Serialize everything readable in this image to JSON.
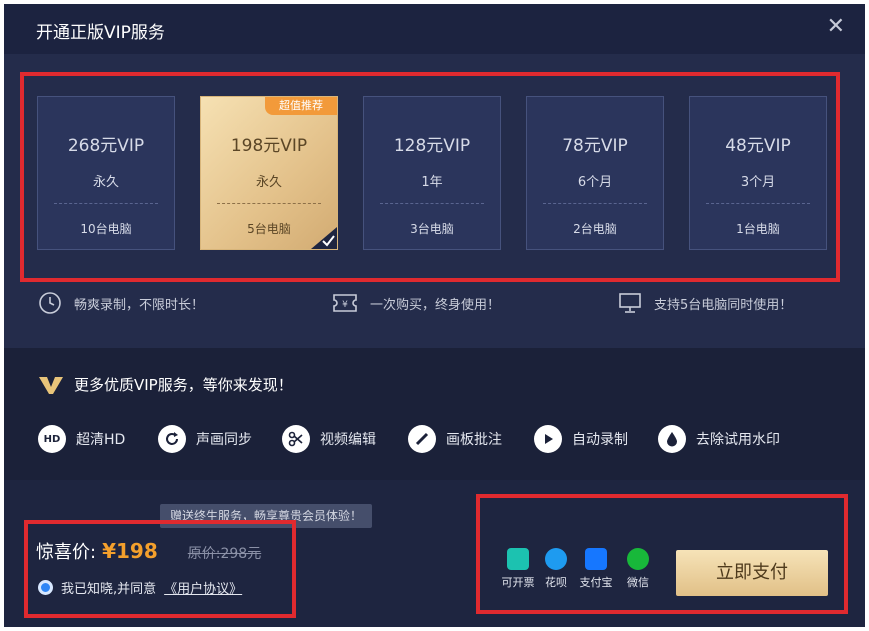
{
  "dialog": {
    "title": "开通正版VIP服务"
  },
  "plans": [
    {
      "name": "268元VIP",
      "period": "永久",
      "pcs": "10台电脑"
    },
    {
      "name": "198元VIP",
      "period": "永久",
      "pcs": "5台电脑",
      "badge": "超值推荐"
    },
    {
      "name": "128元VIP",
      "period": "1年",
      "pcs": "3台电脑"
    },
    {
      "name": "78元VIP",
      "period": "6个月",
      "pcs": "2台电脑"
    },
    {
      "name": "48元VIP",
      "period": "3个月",
      "pcs": "1台电脑"
    }
  ],
  "selected_plan": 1,
  "features": [
    {
      "icon": "clock-icon",
      "text": "畅爽录制，不限时长！"
    },
    {
      "icon": "ticket-icon",
      "text": "一次购买，终身使用！"
    },
    {
      "icon": "monitor-icon",
      "text": "支持5台电脑同时使用！"
    }
  ],
  "more": {
    "title": "更多优质VIP服务，等你来发现！",
    "services": [
      {
        "icon": "hd-icon",
        "label": "超清HD"
      },
      {
        "icon": "sync-icon",
        "label": "声画同步"
      },
      {
        "icon": "scissors-icon",
        "label": "视频编辑"
      },
      {
        "icon": "pen-icon",
        "label": "画板批注"
      },
      {
        "icon": "play-icon",
        "label": "自动录制"
      },
      {
        "icon": "drop-icon",
        "label": "去除试用水印"
      }
    ]
  },
  "payment": {
    "tooltip": "赠送终生服务，畅享尊贵会员体验！",
    "price_label": "惊喜价:",
    "price": "¥198",
    "original": "原价:298元",
    "agree_text": "我已知晓,并同意",
    "agreement_link": "《用户协议》",
    "methods": [
      {
        "name": "可开票",
        "color": "#1cc2b0"
      },
      {
        "name": "花呗",
        "color": "#1e9bf0"
      },
      {
        "name": "支付宝",
        "color": "#1677ff"
      },
      {
        "name": "微信",
        "color": "#18b83a"
      }
    ],
    "pay_button": "立即支付"
  },
  "colors": {
    "accent_gold": "#e3c18a",
    "price_orange": "#f4a02c",
    "highlight_red": "#e02a2f",
    "bg_dark": "#1e2540"
  }
}
